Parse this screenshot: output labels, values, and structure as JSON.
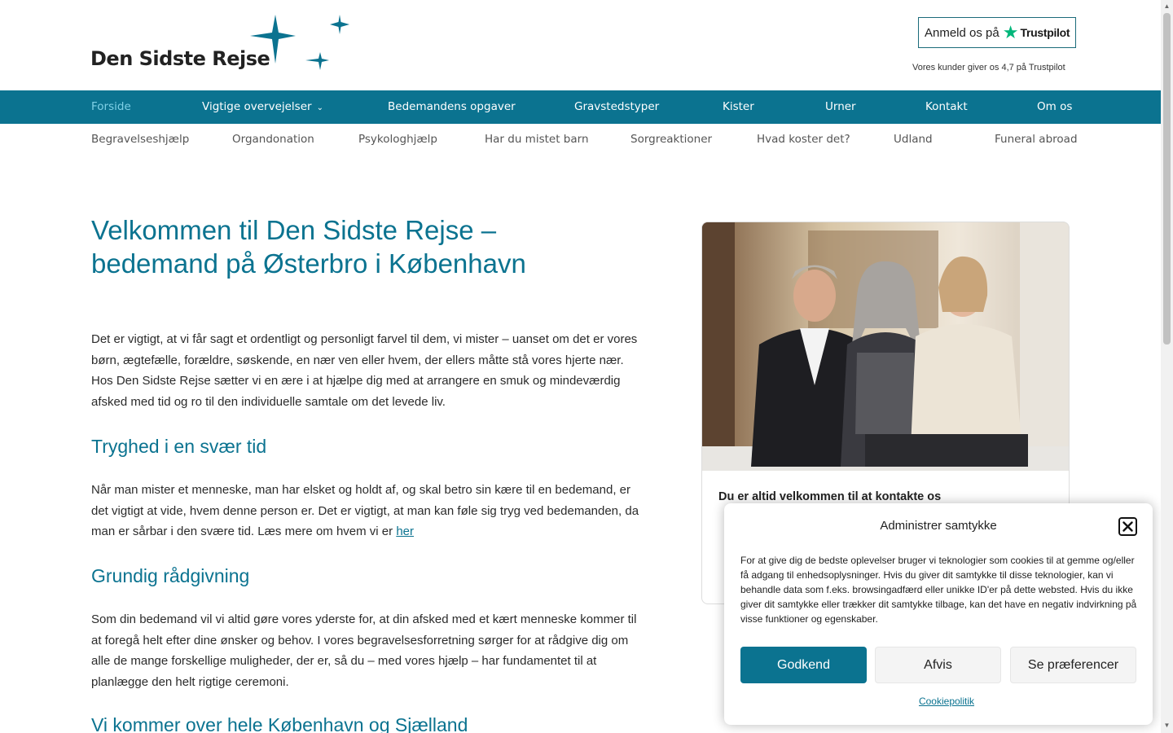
{
  "header": {
    "logo_text": "Den Sidste Rejse",
    "trustpilot_prefix": "Anmeld os på",
    "trustpilot_brand": "Trustpilot",
    "trustpilot_rating": "Vores kunder giver os 4,7 på Trustpilot"
  },
  "nav": {
    "items": [
      "Forside",
      "Vigtige overvejelser",
      "Bedemandens opgaver",
      "Gravstedstyper",
      "Kister",
      "Urner",
      "Kontakt",
      "Om os"
    ],
    "active": "Forside"
  },
  "subnav": {
    "items": [
      "Begravelseshjælp",
      "Organdonation",
      "Psykologhjælp",
      "Har du mistet barn",
      "Sorgreaktioner",
      "Hvad koster det?",
      "Udland",
      "Funeral abroad"
    ]
  },
  "main": {
    "title": "Velkommen til Den Sidste Rejse – bedemand på Østerbro i København",
    "intro": "Det er vigtigt, at vi får sagt et ordentligt og personligt farvel til dem, vi mister – uanset om det er vores børn, ægtefælle, forældre, søskende, en nær ven eller hvem, der ellers måtte stå vores hjerte nær. Hos Den Sidste Rejse sætter vi en ære i at hjælpe dig med at arrangere en smuk og mindeværdig afsked med tid og ro til den individuelle samtale om det levede  liv.",
    "section1_heading": "Tryghed i en svær tid",
    "section1_text": "Når man mister et menneske, man har elsket og holdt af, og skal betro sin kære til en bedemand, er det vigtigt at vide, hvem denne person er. Det er vigtigt, at man kan føle sig tryg ved bedemanden, da man er sårbar i den svære tid. Læs mere om hvem vi er",
    "section1_link": "her",
    "section2_heading": "Grundig rådgivning",
    "section2_text": "Som din bedemand vil vi altid gøre vores yderste for, at din afsked med et kært menneske kommer til at foregå helt efter dine ønsker og behov. I vores begravelsesforretning sørger for at rådgive dig om alle de mange forskellige muligheder, der er,  så du – med vores hjælp – har fundamentet til at planlægge den helt rigtige ceremoni.",
    "section3_heading": "Vi kommer over hele København og Sjælland"
  },
  "card": {
    "heading": "Du er altid velkommen til at kontakte os"
  },
  "consent": {
    "title": "Administrer samtykke",
    "text": "For at give dig de bedste oplevelser bruger vi teknologier som cookies til at gemme og/eller få adgang til enhedsoplysninger. Hvis du giver dit samtykke til disse teknologier, kan vi behandle data som f.eks. browsingadfærd eller unikke ID'er på dette websted. Hvis du ikke giver dit samtykke eller trækker dit samtykke tilbage, kan det have en negativ indvirkning på visse funktioner og egenskaber.",
    "accept": "Godkend",
    "reject": "Afvis",
    "preferences": "Se præferencer",
    "policy_link": "Cookiepolitik"
  },
  "colors": {
    "brand": "#0b7390",
    "trustpilot_green": "#00b67a"
  }
}
